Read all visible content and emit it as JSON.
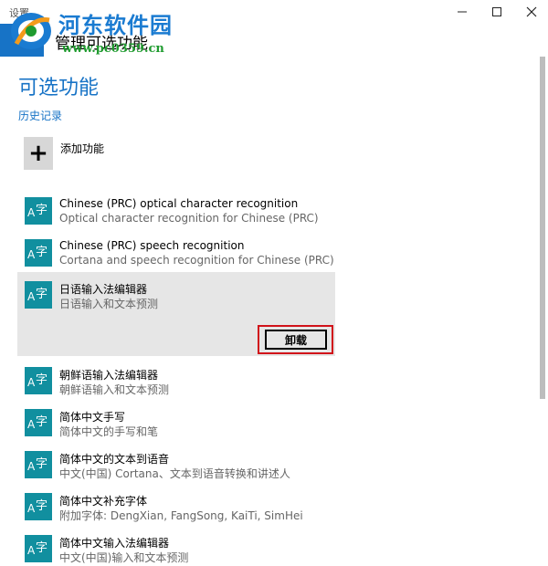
{
  "window": {
    "title": "设置",
    "min_icon": "minimize-icon",
    "max_icon": "maximize-icon",
    "close_icon": "close-icon"
  },
  "header": {
    "back_icon": "back-arrow-icon",
    "title": "管理可选功能"
  },
  "watermark": {
    "line1": "河东软件园",
    "line2": "www.pc0359.cn"
  },
  "page": {
    "heading": "可选功能",
    "history_link": "历史记录",
    "add_feature_label": "添加功能",
    "add_icon": "plus-icon",
    "uninstall_label": "卸载"
  },
  "features": [
    {
      "icon_a": "A",
      "icon_z": "字",
      "name": "Chinese (PRC) optical character recognition",
      "desc": "Optical character recognition for Chinese (PRC)"
    },
    {
      "icon_a": "A",
      "icon_z": "字",
      "name": "Chinese (PRC) speech recognition",
      "desc": "Cortana and speech recognition for Chinese (PRC)"
    },
    {
      "icon_a": "A",
      "icon_z": "字",
      "name": "日语输入法编辑器",
      "desc": "日语输入和文本预测"
    },
    {
      "icon_a": "A",
      "icon_z": "字",
      "name": "朝鲜语输入法编辑器",
      "desc": "朝鲜语输入和文本预测"
    },
    {
      "icon_a": "A",
      "icon_z": "字",
      "name": "简体中文手写",
      "desc": "简体中文的手写和笔"
    },
    {
      "icon_a": "A",
      "icon_z": "字",
      "name": "简体中文的文本到语音",
      "desc": "中文(中国) Cortana、文本到语音转换和讲述人"
    },
    {
      "icon_a": "A",
      "icon_z": "字",
      "name": "简体中文补充字体",
      "desc": "附加字体: DengXian, FangSong, KaiTi, SimHei"
    },
    {
      "icon_a": "A",
      "icon_z": "字",
      "name": "简体中文输入法编辑器",
      "desc": "中文(中国)输入和文本预测"
    }
  ],
  "colors": {
    "accent": "#1773c6",
    "icon_bg": "#118f9f",
    "selected_bg": "#e6e6e6",
    "highlight_border": "#d1121a"
  }
}
